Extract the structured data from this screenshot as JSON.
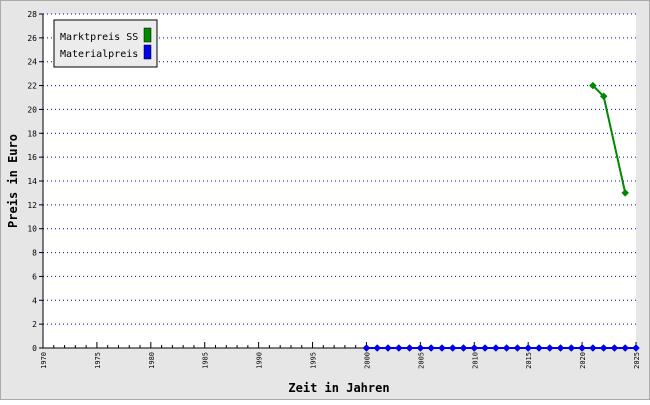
{
  "chart_data": {
    "type": "line",
    "title": "",
    "xlabel": "Zeit in Jahren",
    "ylabel": "Preis in Euro",
    "xlim": [
      1970,
      2025
    ],
    "ylim": [
      0,
      28
    ],
    "x_ticks": [
      "1970",
      "1975",
      "1980",
      "1985",
      "1990",
      "1995",
      "2000",
      "2005",
      "2010",
      "2015",
      "2020",
      "2025"
    ],
    "y_ticks": [
      "0",
      "2",
      "4",
      "6",
      "8",
      "10",
      "12",
      "14",
      "16",
      "18",
      "20",
      "22",
      "24",
      "26",
      "28"
    ],
    "grid": "horizontal dotted",
    "legend_position": "top-left",
    "series": [
      {
        "name": "Marktpreis SS",
        "color": "#008800",
        "x": [
          2021,
          2022,
          2024
        ],
        "y": [
          22,
          21.1,
          13
        ]
      },
      {
        "name": "Materialpreis",
        "color": "#0000ee",
        "x": [
          2000,
          2001,
          2002,
          2003,
          2004,
          2005,
          2006,
          2007,
          2008,
          2009,
          2010,
          2011,
          2012,
          2013,
          2014,
          2015,
          2016,
          2017,
          2018,
          2019,
          2020,
          2021,
          2022,
          2023,
          2024,
          2025
        ],
        "y": [
          0,
          0,
          0,
          0,
          0,
          0,
          0,
          0,
          0,
          0,
          0,
          0,
          0,
          0,
          0,
          0,
          0,
          0,
          0,
          0,
          0,
          0,
          0,
          0,
          0,
          0
        ]
      }
    ]
  }
}
